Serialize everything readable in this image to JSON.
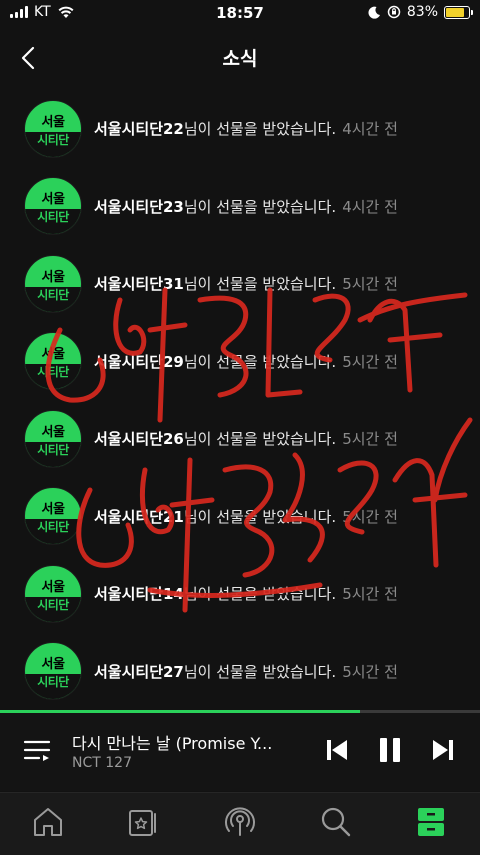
{
  "status_bar": {
    "carrier": "KT",
    "time": "18:57",
    "battery_percent": "83%",
    "battery_level": 0.83,
    "icons": [
      "signal-icon",
      "wifi-icon",
      "moon-icon",
      "orientation-lock-icon",
      "battery-icon"
    ]
  },
  "header": {
    "title": "소식",
    "back_icon": "chevron-left-icon"
  },
  "avatar": {
    "top": "서울",
    "bottom": "시티단"
  },
  "notifications": [
    {
      "name": "서울시티단22",
      "message": "님이 선물을 받았습니다.",
      "time": "4시간 전"
    },
    {
      "name": "서울시티단23",
      "message": "님이 선물을 받았습니다.",
      "time": "4시간 전"
    },
    {
      "name": "서울시티단31",
      "message": "님이 선물을 받았습니다.",
      "time": "5시간 전"
    },
    {
      "name": "서울시티단29",
      "message": "님이 선물을 받았습니다.",
      "time": "5시간 전"
    },
    {
      "name": "서울시티단26",
      "message": "님이 선물을 받았습니다.",
      "time": "5시간 전"
    },
    {
      "name": "서울시티단21",
      "message": "님이 선물을 받았습니다.",
      "time": "5시간 전"
    },
    {
      "name": "서울시티단14",
      "message": "님이 선물을 받았습니다.",
      "time": "5시간 전"
    },
    {
      "name": "서울시티단27",
      "message": "님이 선물을 받았습니다.",
      "time": "5시간 전"
    }
  ],
  "player": {
    "title": "다시 만나는 날 (Promise Y...",
    "artist": "NCT 127",
    "progress": 0.75,
    "icons": [
      "playlist-icon",
      "previous-icon",
      "pause-icon",
      "next-icon"
    ]
  },
  "bottom_nav": {
    "items": [
      "home-icon",
      "storage-icon",
      "podcast-icon",
      "search-icon",
      "library-icon"
    ],
    "active": "library-icon"
  },
  "colors": {
    "accent": "#2bd15a",
    "background": "#121212",
    "scribble": "#d8281e",
    "battery": "#f2d12b"
  }
}
